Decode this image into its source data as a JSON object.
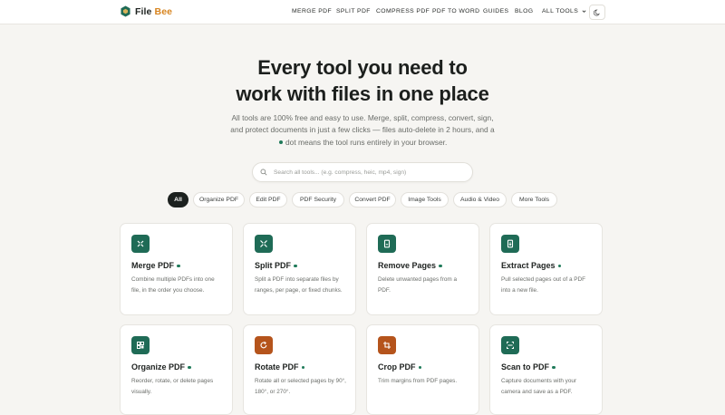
{
  "brand": {
    "name_part1": "File ",
    "name_part2": "Bee"
  },
  "nav": {
    "items": [
      "MERGE PDF",
      "SPLIT PDF",
      "COMPRESS PDF",
      "PDF TO WORD",
      "GUIDES",
      "BLOG",
      "ALL TOOLS"
    ]
  },
  "hero": {
    "title_line1": "Every tool you need to",
    "title_line2": "work with files in one place",
    "subtitle_line1": "All tools are 100% free and easy to use. Merge, split, compress, convert, sign,",
    "subtitle_line2": "and protect documents in just a few clicks — files auto-delete in 2 hours, and a",
    "subtitle_line3": "dot means the tool runs entirely in your browser."
  },
  "search": {
    "placeholder": "Search all tools... (e.g. compress, heic, mp4, sign)"
  },
  "filters": [
    "All",
    "Organize PDF",
    "Edit PDF",
    "PDF Security",
    "Convert PDF",
    "Image Tools",
    "Audio & Video",
    "More Tools"
  ],
  "colors": {
    "green": "#1f6b56",
    "orange": "#b5541c",
    "dot": "#1f7a5a"
  },
  "tools": [
    {
      "title": "Merge PDF",
      "desc": "Combine multiple PDFs into one file, in the order you choose.",
      "icon": "merge-icon",
      "color": "#1f6b56"
    },
    {
      "title": "Split PDF",
      "desc": "Split a PDF into separate files by ranges, per page, or fixed chunks.",
      "icon": "split-icon",
      "color": "#1f6b56"
    },
    {
      "title": "Remove Pages",
      "desc": "Delete unwanted pages from a PDF.",
      "icon": "remove-pages-icon",
      "color": "#1f6b56"
    },
    {
      "title": "Extract Pages",
      "desc": "Pull selected pages out of a PDF into a new file.",
      "icon": "extract-pages-icon",
      "color": "#1f6b56"
    },
    {
      "title": "Organize PDF",
      "desc": "Reorder, rotate, or delete pages visually.",
      "icon": "organize-icon",
      "color": "#1f6b56"
    },
    {
      "title": "Rotate PDF",
      "desc": "Rotate all or selected pages by 90°, 180°, or 270°.",
      "icon": "rotate-icon",
      "color": "#b5541c"
    },
    {
      "title": "Crop PDF",
      "desc": "Trim margins from PDF pages.",
      "icon": "crop-icon",
      "color": "#b5541c"
    },
    {
      "title": "Scan to PDF",
      "desc": "Capture documents with your camera and save as a PDF.",
      "icon": "scan-icon",
      "color": "#1f6b56"
    }
  ]
}
